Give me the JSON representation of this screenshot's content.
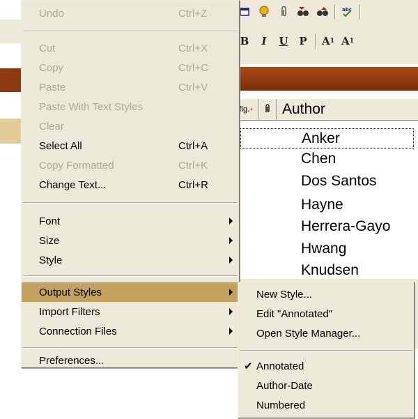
{
  "colors": {
    "menu_bg": "#ece9d8",
    "highlight": "#c3a25f",
    "disabled_text": "#aca899",
    "title_bar": "#8e3a10"
  },
  "main_menu": {
    "items": [
      {
        "label": "Undo",
        "shortcut": "Ctrl+Z",
        "disabled": true
      },
      {
        "label": "Cut",
        "shortcut": "Ctrl+X",
        "disabled": true
      },
      {
        "label": "Copy",
        "shortcut": "Ctrl+C",
        "disabled": true
      },
      {
        "label": "Paste",
        "shortcut": "Ctrl+V",
        "disabled": true
      },
      {
        "label": "Paste With Text Styles",
        "shortcut": "",
        "disabled": true
      },
      {
        "label": "Clear",
        "shortcut": "",
        "disabled": true
      },
      {
        "label": "Select All",
        "shortcut": "Ctrl+A",
        "disabled": false
      },
      {
        "label": "Copy Formatted",
        "shortcut": "Ctrl+K",
        "disabled": true
      },
      {
        "label": "Change Text...",
        "shortcut": "Ctrl+R",
        "disabled": false
      },
      {
        "label": "Font",
        "submenu": true
      },
      {
        "label": "Size",
        "submenu": true
      },
      {
        "label": "Style",
        "submenu": true
      },
      {
        "label": "Output Styles",
        "submenu": true,
        "highlighted": true
      },
      {
        "label": "Import Filters",
        "submenu": true
      },
      {
        "label": "Connection Files",
        "submenu": true
      },
      {
        "label": "Preferences..."
      }
    ]
  },
  "output_styles_submenu": {
    "items": [
      {
        "label": "New Style..."
      },
      {
        "label": "Edit \"Annotated\""
      },
      {
        "label": "Open Style Manager..."
      },
      {
        "label": "Annotated",
        "checked": true,
        "check_glyph": "✔"
      },
      {
        "label": "Author-Date"
      },
      {
        "label": "Numbered"
      }
    ]
  },
  "toolbar": {
    "format_buttons": [
      "B",
      "I",
      "U",
      "P",
      "A",
      "A"
    ],
    "icons": [
      "window-icon",
      "light-bulb-icon",
      "paperclip-icon",
      "find-icon",
      "find-up-icon",
      "spell-check-icon"
    ]
  },
  "reference_list": {
    "columns": [
      "fig.",
      "Author"
    ],
    "rows": [
      "Anker",
      "Chen",
      "Dos Santos",
      "Hayne",
      "Herrera-Gayo",
      "Hwang",
      "Knudsen"
    ]
  }
}
